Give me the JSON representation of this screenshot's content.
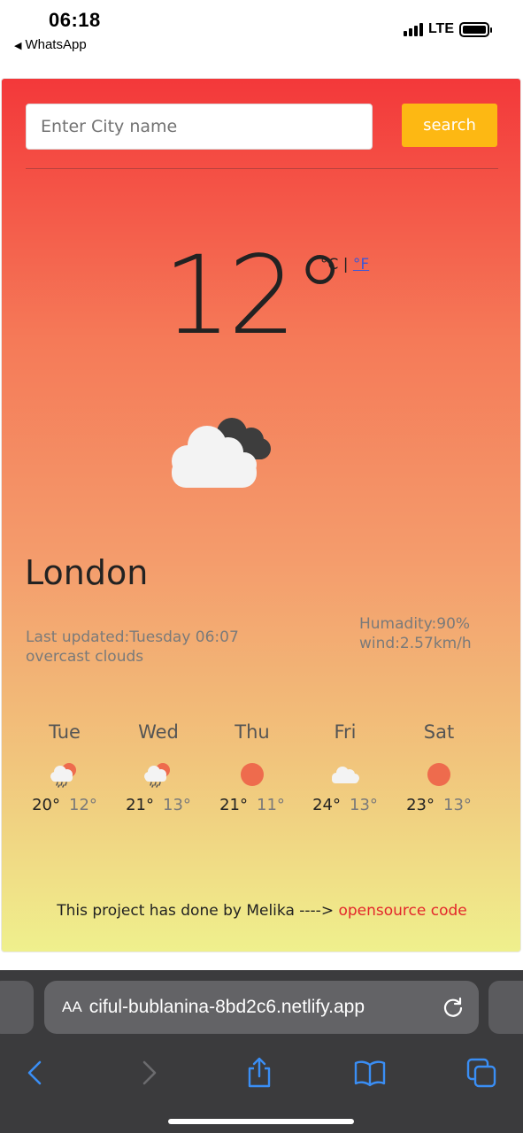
{
  "status_bar": {
    "time": "06:18",
    "back_app": "WhatsApp",
    "network": "LTE"
  },
  "search": {
    "placeholder": "Enter City name",
    "button_label": "search"
  },
  "current": {
    "temperature": "12°",
    "unit_c": "°C",
    "unit_sep": "|",
    "unit_f": "°F",
    "icon": "overcast-clouds-icon",
    "city": "London",
    "last_updated": "Last updated:Tuesday 06:07",
    "description": "overcast clouds",
    "humidity": "Humadity:90%",
    "wind": "wind:2.57km/h"
  },
  "forecast": [
    {
      "day": "Tue",
      "high": "20°",
      "low": "12°",
      "icon": "rain-sun-icon"
    },
    {
      "day": "Wed",
      "high": "21°",
      "low": "13°",
      "icon": "rain-sun-icon"
    },
    {
      "day": "Thu",
      "high": "21°",
      "low": "11°",
      "icon": "sun-icon"
    },
    {
      "day": "Fri",
      "high": "24°",
      "low": "13°",
      "icon": "cloud-icon"
    },
    {
      "day": "Sat",
      "high": "23°",
      "low": "13°",
      "icon": "sun-icon"
    }
  ],
  "footer": {
    "text": "This project has done by Melika ---->",
    "link": "opensource code"
  },
  "browser": {
    "aa": "AA",
    "url": "ciful-bublanina-8bd2c6.netlify.app"
  },
  "colors": {
    "accent_button": "#fdb813",
    "link": "#e3272b",
    "sun": "#ee6b4d"
  }
}
